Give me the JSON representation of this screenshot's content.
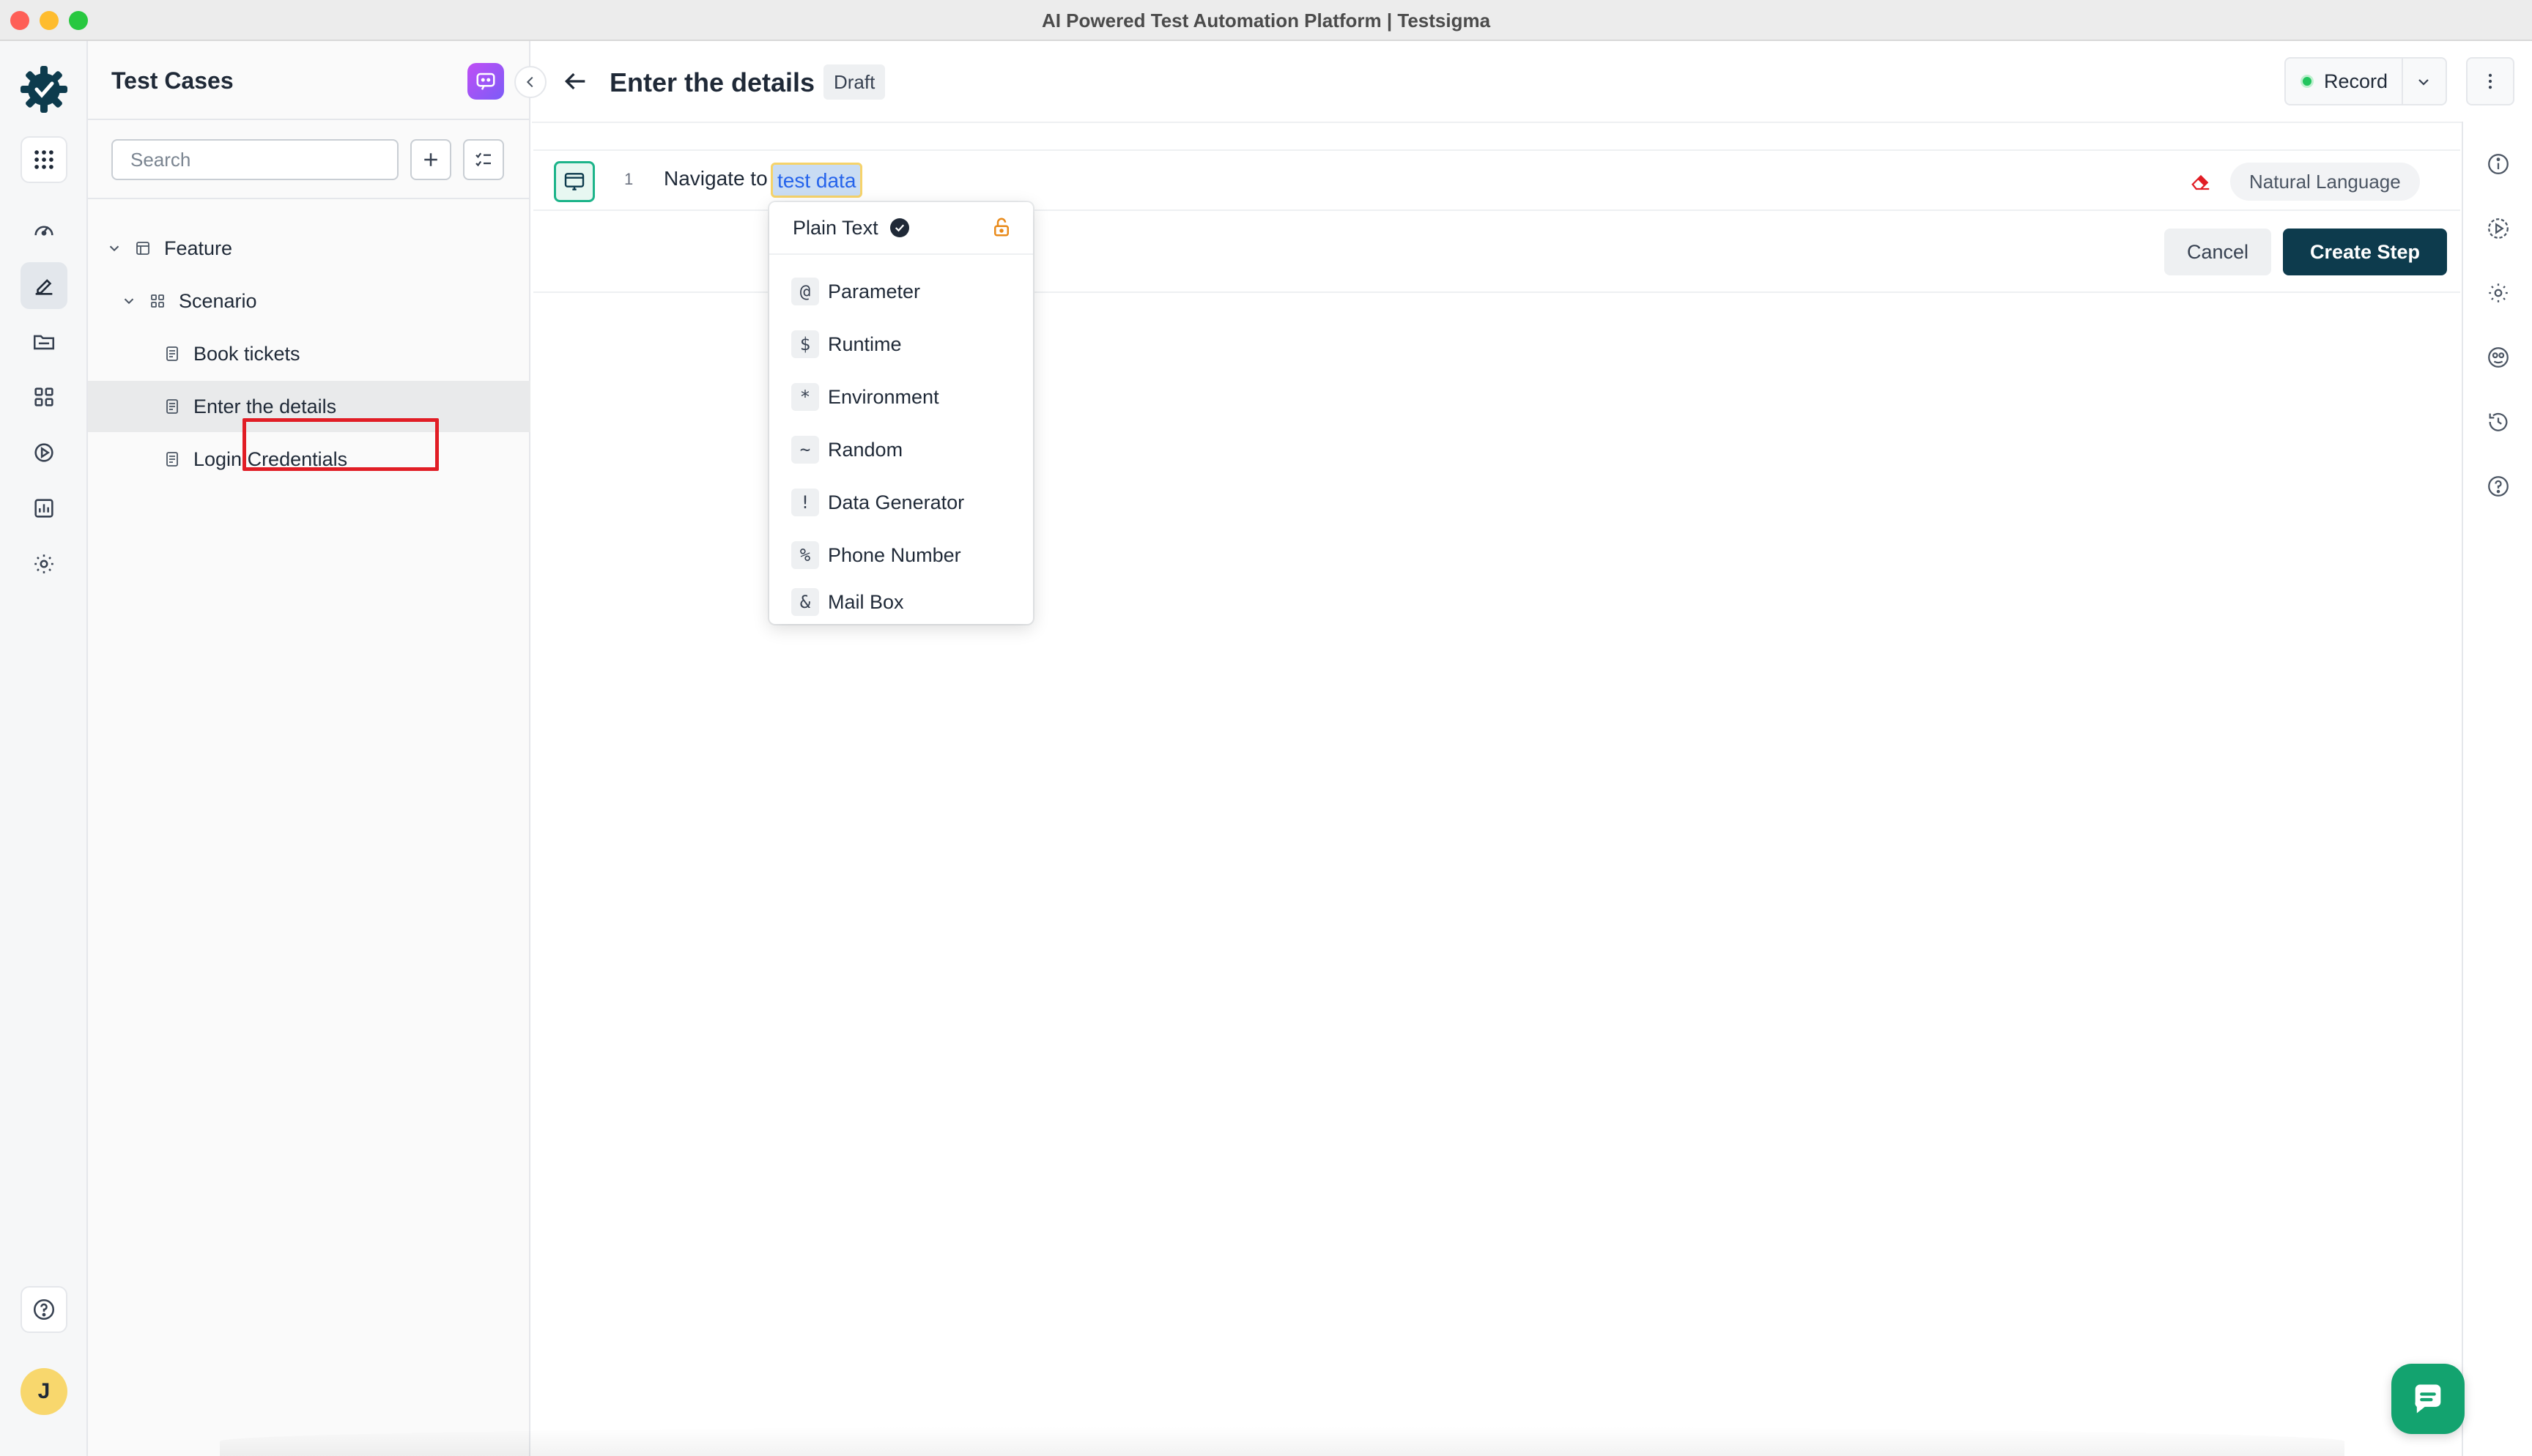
{
  "window": {
    "title": "AI Powered Test Automation Platform | Testsigma"
  },
  "rail": {
    "items": [
      {
        "name": "apps-icon"
      },
      {
        "name": "dashboard-icon"
      },
      {
        "name": "test-cases-icon"
      },
      {
        "name": "test-data-icon"
      },
      {
        "name": "elements-icon"
      },
      {
        "name": "runs-icon"
      },
      {
        "name": "reports-icon"
      },
      {
        "name": "settings-icon"
      }
    ],
    "avatar_initial": "J"
  },
  "panel": {
    "title": "Test Cases",
    "search_placeholder": "Search",
    "tree": [
      {
        "label": "Feature",
        "type": "feature"
      },
      {
        "label": "Scenario",
        "type": "scenario"
      },
      {
        "label": "Book tickets",
        "type": "testcase"
      },
      {
        "label": "Enter the details",
        "type": "testcase",
        "selected": true
      },
      {
        "label": "Login Credentials",
        "type": "testcase"
      }
    ]
  },
  "header": {
    "title": "Enter the details",
    "status_badge": "Draft",
    "record_label": "Record"
  },
  "step": {
    "number": "1",
    "prefix": "Navigate to",
    "token": "test data",
    "mode": "Natural Language"
  },
  "actions": {
    "cancel_label": "Cancel",
    "create_label": "Create Step"
  },
  "test_data_menu": {
    "selected": "Plain Text",
    "items": [
      {
        "symbol": "@",
        "label": "Parameter"
      },
      {
        "symbol": "$",
        "label": "Runtime"
      },
      {
        "symbol": "*",
        "label": "Environment"
      },
      {
        "symbol": "~",
        "label": "Random"
      },
      {
        "symbol": "!",
        "label": "Data Generator"
      },
      {
        "symbol": "%",
        "label": "Phone Number"
      },
      {
        "symbol": "&",
        "label": "Mail Box"
      }
    ]
  },
  "colors": {
    "primary_dark": "#0d3b4d",
    "accent_green": "#13a36f",
    "highlight_red": "#e11d25",
    "token_border": "#f6d36a"
  }
}
